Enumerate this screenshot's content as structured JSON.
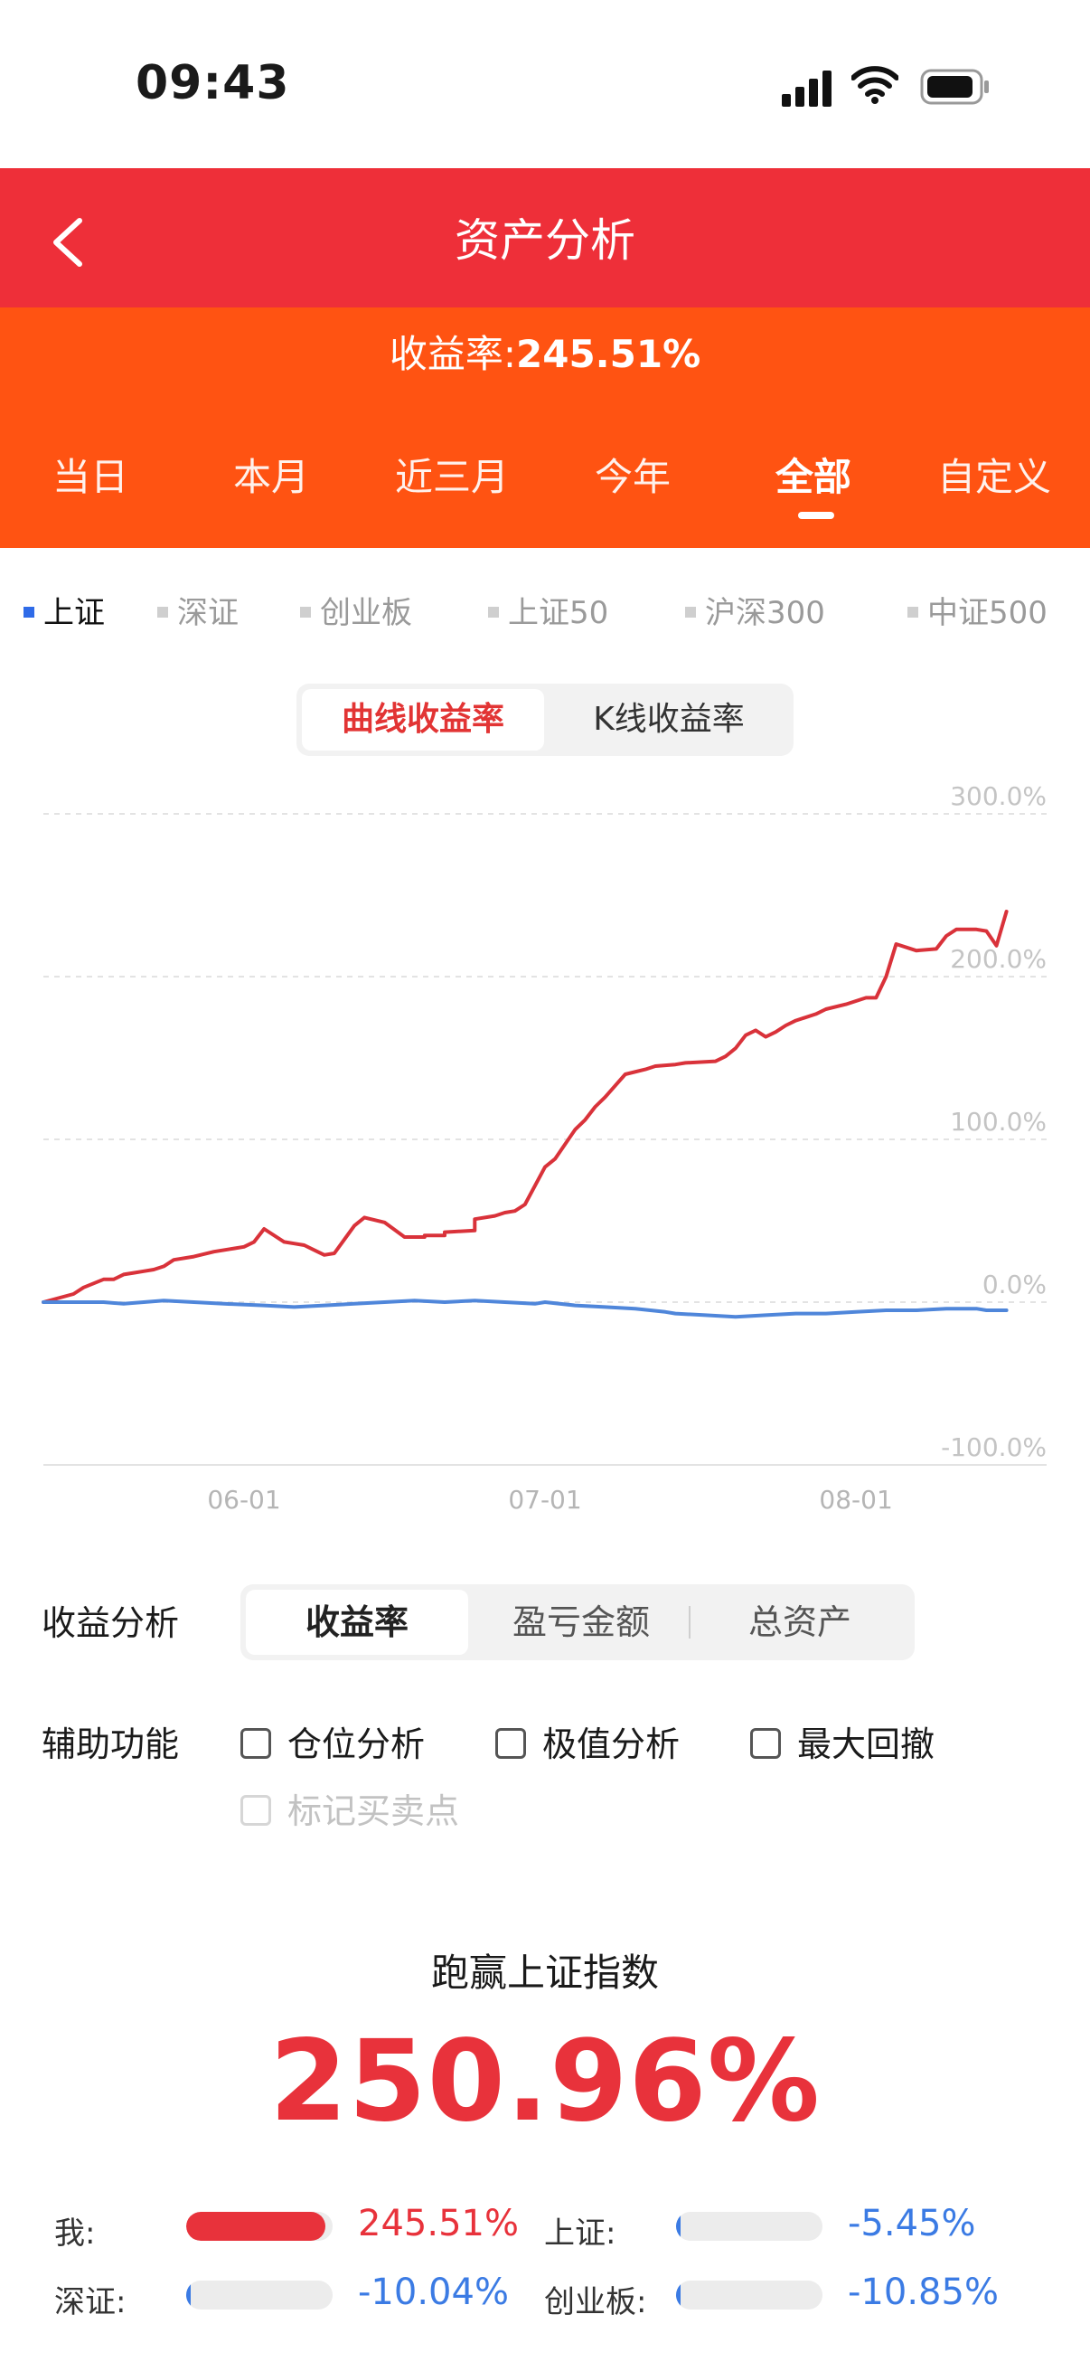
{
  "status_bar": {
    "time": "09:43"
  },
  "header": {
    "title": "资产分析"
  },
  "summary": {
    "return_label": "收益率:",
    "return_value": "245.51%"
  },
  "period_tabs": [
    {
      "label": "当日",
      "active": false
    },
    {
      "label": "本月",
      "active": false
    },
    {
      "label": "近三月",
      "active": false
    },
    {
      "label": "今年",
      "active": false
    },
    {
      "label": "全部",
      "active": true
    },
    {
      "label": "自定义",
      "active": false
    }
  ],
  "index_tabs": [
    {
      "label": "上证",
      "active": true
    },
    {
      "label": "深证",
      "active": false
    },
    {
      "label": "创业板",
      "active": false
    },
    {
      "label": "上证50",
      "active": false
    },
    {
      "label": "沪深300",
      "active": false
    },
    {
      "label": "中证500",
      "active": false
    }
  ],
  "chart_type_toggle": {
    "options": [
      "曲线收益率",
      "K线收益率"
    ],
    "selected": "曲线收益率"
  },
  "chart_data": {
    "type": "line",
    "ylim": [
      -100,
      300
    ],
    "y_ticks": [
      "300.0%",
      "200.0%",
      "100.0%",
      "0.0%",
      "-100.0%"
    ],
    "y_tick_values": [
      300,
      200,
      100,
      0,
      -100
    ],
    "x_ticks": [
      "06-01",
      "07-01",
      "08-01"
    ],
    "x_tick_positions": [
      20,
      50,
      81
    ],
    "x_range": [
      0,
      100
    ],
    "grid": true,
    "series": [
      {
        "color": "#d9323a",
        "x": [
          0,
          3,
          4,
          6,
          7,
          8,
          9,
          10,
          11,
          12,
          13,
          15,
          17,
          19,
          20,
          21,
          22,
          24,
          25,
          26,
          27,
          28,
          29,
          31,
          32,
          34,
          36,
          38,
          38,
          40,
          40,
          43,
          43,
          45,
          46,
          47,
          48,
          50,
          51,
          53,
          54,
          55,
          56,
          57,
          58,
          60,
          61,
          63,
          64,
          67,
          68,
          69,
          70,
          71,
          72,
          73,
          74,
          75,
          77,
          78,
          80,
          82,
          83,
          84,
          85,
          87,
          89,
          90,
          91,
          93,
          94,
          95,
          96
        ],
        "values": [
          0,
          5,
          9,
          14,
          14,
          17,
          18,
          19,
          20,
          22,
          26,
          28,
          31,
          33,
          34,
          37,
          45,
          37,
          36,
          35,
          32,
          29,
          30,
          47,
          52,
          49,
          40,
          40,
          41,
          41,
          43,
          44,
          51,
          53,
          55,
          56,
          60,
          83,
          88,
          106,
          112,
          120,
          126,
          133,
          140,
          143,
          145,
          146,
          147,
          148,
          151,
          156,
          164,
          167,
          163,
          166,
          170,
          173,
          177,
          180,
          183,
          187,
          187,
          200,
          220,
          216,
          217,
          225,
          229,
          229,
          228,
          219,
          240
        ]
      },
      {
        "color": "#4f86da",
        "x": [
          0,
          6,
          8,
          10,
          12,
          15,
          18,
          22,
          25,
          28,
          31,
          34,
          37,
          40,
          43,
          46,
          49,
          50,
          53,
          56,
          59,
          62,
          63,
          66,
          69,
          72,
          75,
          78,
          81,
          84,
          87,
          90,
          93,
          94,
          96
        ],
        "values": [
          0,
          0,
          -1,
          0,
          1,
          0,
          -1,
          -2,
          -3,
          -2,
          -1,
          0,
          1,
          0,
          1,
          0,
          -1,
          0,
          -2,
          -3,
          -4,
          -6,
          -7,
          -8,
          -9,
          -8,
          -7,
          -7,
          -6,
          -5,
          -5,
          -4,
          -4,
          -5,
          -5
        ]
      }
    ]
  },
  "analysis": {
    "label": "收益分析",
    "options": [
      "收益率",
      "盈亏金额",
      "总资产"
    ],
    "selected": "收益率"
  },
  "aux": {
    "label": "辅助功能",
    "options": [
      {
        "label": "仓位分析",
        "checked": false,
        "disabled": false
      },
      {
        "label": "极值分析",
        "checked": false,
        "disabled": false
      },
      {
        "label": "最大回撤",
        "checked": false,
        "disabled": false
      },
      {
        "label": "标记买卖点",
        "checked": false,
        "disabled": true
      }
    ]
  },
  "beat": {
    "title": "跑赢上证指数",
    "value": "250.96%"
  },
  "comparison": [
    {
      "label": "我:",
      "value": "245.51%",
      "fill": 0.95,
      "color": "#e8323b"
    },
    {
      "label": "上证:",
      "value": "-5.45%",
      "fill": 0.025,
      "color": "#3b7be4"
    },
    {
      "label": "深证:",
      "value": "-10.04%",
      "fill": 0.03,
      "color": "#3b7be4"
    },
    {
      "label": "创业板:",
      "value": "-10.85%",
      "fill": 0.03,
      "color": "#3b7be4"
    }
  ]
}
